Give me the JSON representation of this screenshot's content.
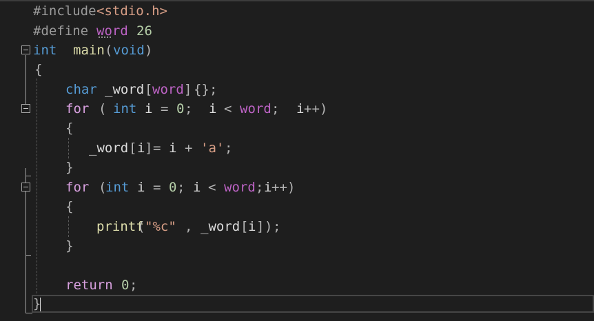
{
  "editor": {
    "language": "C",
    "lines": [
      {
        "tokens": [
          "#include",
          "<stdio.h>"
        ]
      },
      {
        "tokens": [
          "#define",
          "word",
          "26"
        ]
      },
      {
        "tokens": [
          "int",
          "main",
          "(",
          "void",
          ")"
        ]
      },
      {
        "tokens": [
          "{"
        ]
      },
      {
        "tokens": [
          "char",
          "_word",
          "[",
          "word",
          "]",
          "{}",
          ";"
        ]
      },
      {
        "tokens": [
          "for",
          "(",
          "int",
          "i",
          "=",
          "0",
          ";",
          "i",
          "<",
          "word",
          ";",
          "i",
          "++",
          ")"
        ]
      },
      {
        "tokens": [
          "{"
        ]
      },
      {
        "tokens": [
          "_word",
          "[",
          "i",
          "]",
          "=",
          "i",
          "+",
          "'a'",
          ";"
        ]
      },
      {
        "tokens": [
          "}"
        ]
      },
      {
        "tokens": [
          "for",
          "(",
          "int",
          "i",
          "=",
          "0",
          ";",
          "i",
          "<",
          "word",
          ";",
          "i",
          "++",
          ")"
        ]
      },
      {
        "tokens": [
          "{"
        ]
      },
      {
        "tokens": [
          "printf",
          "(",
          "\"%c\"",
          ",",
          "_word",
          "[",
          "i",
          "]",
          ")",
          ";"
        ]
      },
      {
        "tokens": [
          "}"
        ]
      },
      {
        "tokens": []
      },
      {
        "tokens": [
          "return",
          "0",
          ";"
        ]
      },
      {
        "tokens": [
          "}"
        ]
      }
    ]
  },
  "colors": {
    "background": "#1e1e1e",
    "keyword": "#569cd6",
    "preprocessor": "#9b9b9b",
    "macro": "#bd63c5",
    "number": "#b5cea8",
    "string": "#d69d85",
    "function": "#dcdcaa",
    "text": "#dcdcdc"
  }
}
